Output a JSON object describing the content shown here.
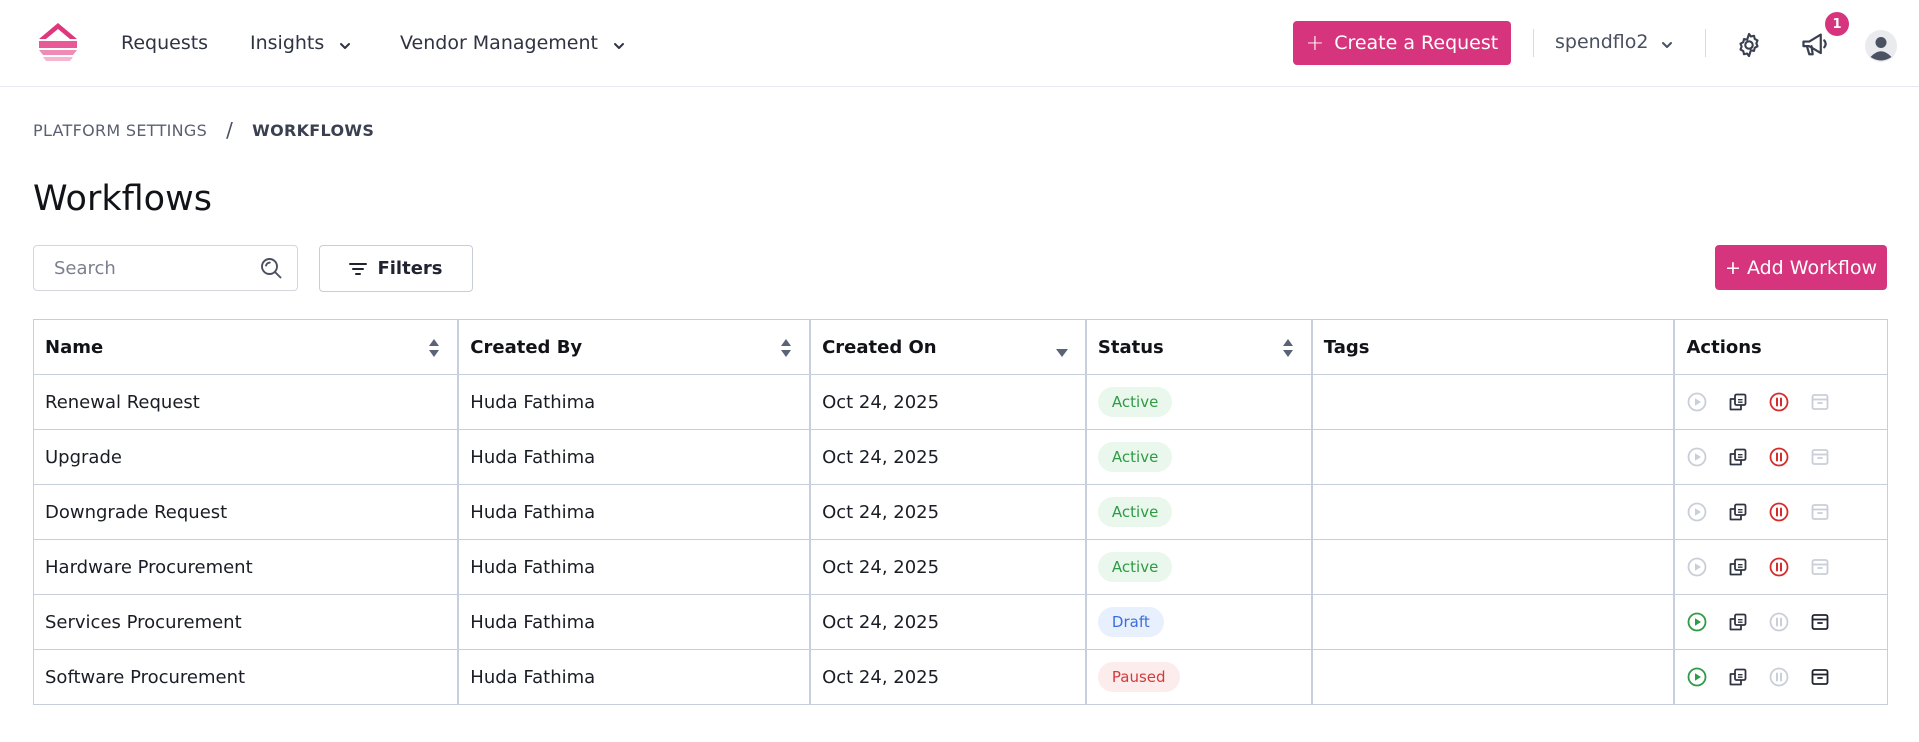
{
  "header": {
    "nav": [
      {
        "label": "Requests",
        "has_dropdown": false
      },
      {
        "label": "Insights",
        "has_dropdown": true
      },
      {
        "label": "Vendor Management",
        "has_dropdown": true
      }
    ],
    "create_button": "Create a Request",
    "org_name": "spendflo2",
    "notification_count": "1",
    "icons": [
      "spendflo-logo-icon",
      "settings-gear-icon",
      "announcement-megaphone-icon",
      "user-avatar-icon"
    ]
  },
  "breadcrumb": {
    "parent": "PLATFORM SETTINGS",
    "separator": "/",
    "current": "WORKFLOWS"
  },
  "page_title": "Workflows",
  "toolbar": {
    "search_placeholder": "Search",
    "search_value": "",
    "filters_label": "Filters",
    "add_label": "+ Add Workflow"
  },
  "table": {
    "columns": [
      {
        "label": "Name",
        "sort": "both"
      },
      {
        "label": "Created By",
        "sort": "both"
      },
      {
        "label": "Created On",
        "sort": "desc"
      },
      {
        "label": "Status",
        "sort": "both"
      },
      {
        "label": "Tags",
        "sort": "none"
      },
      {
        "label": "Actions",
        "sort": "none"
      }
    ],
    "rows": [
      {
        "name": "Renewal Request",
        "created_by": "Huda Fathima",
        "created_on": "Oct 24, 2025",
        "status": "Active",
        "tags": "",
        "play_enabled": false,
        "pause_enabled": true,
        "archive_enabled": false
      },
      {
        "name": "Upgrade",
        "created_by": "Huda Fathima",
        "created_on": "Oct 24, 2025",
        "status": "Active",
        "tags": "",
        "play_enabled": false,
        "pause_enabled": true,
        "archive_enabled": false
      },
      {
        "name": "Downgrade Request",
        "created_by": "Huda Fathima",
        "created_on": "Oct 24, 2025",
        "status": "Active",
        "tags": "",
        "play_enabled": false,
        "pause_enabled": true,
        "archive_enabled": false
      },
      {
        "name": "Hardware Procurement",
        "created_by": "Huda Fathima",
        "created_on": "Oct 24, 2025",
        "status": "Active",
        "tags": "",
        "play_enabled": false,
        "pause_enabled": true,
        "archive_enabled": false
      },
      {
        "name": "Services Procurement",
        "created_by": "Huda Fathima",
        "created_on": "Oct 24, 2025",
        "status": "Draft",
        "tags": "",
        "play_enabled": true,
        "pause_enabled": false,
        "archive_enabled": true
      },
      {
        "name": "Software Procurement",
        "created_by": "Huda Fathima",
        "created_on": "Oct 24, 2025",
        "status": "Paused",
        "tags": "",
        "play_enabled": true,
        "pause_enabled": false,
        "archive_enabled": true
      }
    ]
  },
  "colors": {
    "brand": "#d6357d",
    "status": {
      "Active": {
        "bg": "#eaf7ec",
        "fg": "#2e9b45"
      },
      "Draft": {
        "bg": "#e9f0fd",
        "fg": "#3b6fd8"
      },
      "Paused": {
        "bg": "#fdecec",
        "fg": "#d23b3b"
      }
    },
    "play_enabled": "#2e9b45",
    "pause_enabled": "#d62b2b",
    "disabled": "#c9ced8",
    "copy": "#2f3442",
    "archive_enabled": "#1f2430"
  }
}
